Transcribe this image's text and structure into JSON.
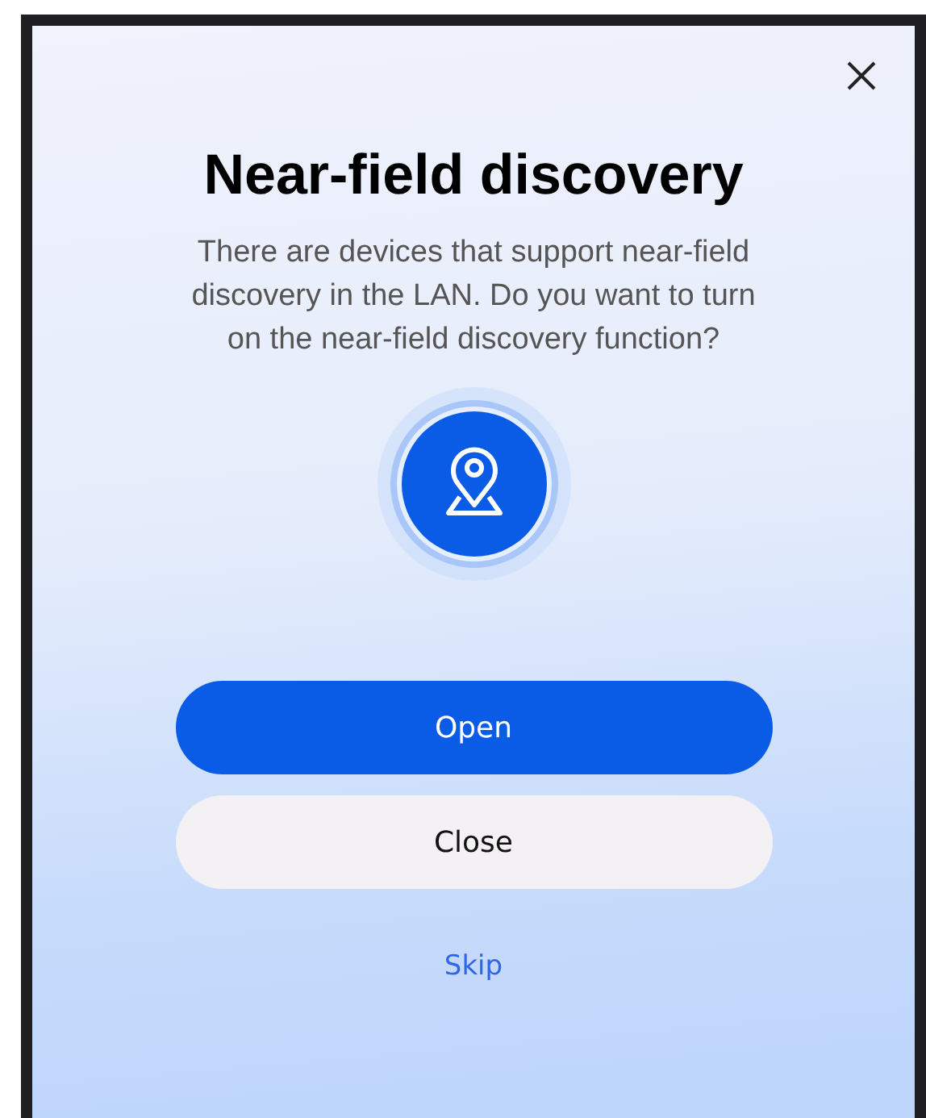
{
  "dialog": {
    "title": "Near-field discovery",
    "message": "There are devices that support near-field discovery in the LAN. Do you want to turn on the near-field discovery function?",
    "buttons": [
      {
        "label": "Open",
        "kind": "primary"
      },
      {
        "label": "Close",
        "kind": "secondary"
      }
    ],
    "link": "Skip"
  }
}
